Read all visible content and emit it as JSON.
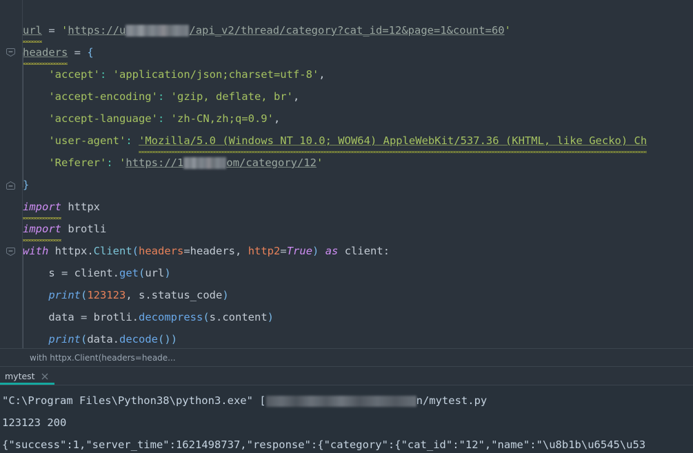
{
  "app": {
    "theme": "dark",
    "editor_bg": "#2b333c",
    "console_bg": "#28313a",
    "accent": "#15a9a0",
    "gutter_divider": "#3b444e"
  },
  "editor": {
    "language": "python",
    "lines": [
      {
        "id": "line-url",
        "fold": false,
        "tokens": [
          {
            "kind": "var-underline-squiggle",
            "text": "url"
          },
          {
            "kind": "plain",
            "text": " "
          },
          {
            "kind": "operator",
            "text": "="
          },
          {
            "kind": "plain",
            "text": " "
          },
          {
            "kind": "string-quote",
            "text": "'"
          },
          {
            "kind": "url",
            "text": "https://"
          },
          {
            "kind": "url-fragment",
            "text": "u"
          },
          {
            "kind": "redaction",
            "text": ""
          },
          {
            "kind": "url",
            "text": "/api_v2/thread/category?cat_id=12&page=1&count=60"
          },
          {
            "kind": "string-quote",
            "text": "'"
          }
        ]
      },
      {
        "id": "line-headers-open",
        "fold": true,
        "tokens": [
          {
            "kind": "var-underline-squiggle",
            "text": "headers"
          },
          {
            "kind": "plain",
            "text": " "
          },
          {
            "kind": "operator",
            "text": "="
          },
          {
            "kind": "plain",
            "text": " "
          },
          {
            "kind": "brace",
            "text": "{"
          }
        ]
      },
      {
        "id": "line-accept",
        "fold": false,
        "tokens": [
          {
            "kind": "plain",
            "text": "    "
          },
          {
            "kind": "string",
            "text": "'accept'"
          },
          {
            "kind": "colon",
            "text": ":"
          },
          {
            "kind": "plain",
            "text": " "
          },
          {
            "kind": "string",
            "text": "'application/json;charset=utf-8'"
          },
          {
            "kind": "punct",
            "text": ","
          }
        ]
      },
      {
        "id": "line-accept-encoding",
        "fold": false,
        "tokens": [
          {
            "kind": "plain",
            "text": "    "
          },
          {
            "kind": "string",
            "text": "'accept-encoding'"
          },
          {
            "kind": "colon",
            "text": ":"
          },
          {
            "kind": "plain",
            "text": " "
          },
          {
            "kind": "string",
            "text": "'gzip, deflate, br'"
          },
          {
            "kind": "punct",
            "text": ","
          }
        ]
      },
      {
        "id": "line-accept-language",
        "fold": false,
        "tokens": [
          {
            "kind": "plain",
            "text": "    "
          },
          {
            "kind": "string",
            "text": "'accept-language'"
          },
          {
            "kind": "colon",
            "text": ":"
          },
          {
            "kind": "plain",
            "text": " "
          },
          {
            "kind": "string",
            "text": "'zh-CN,zh;q=0.9'"
          },
          {
            "kind": "punct",
            "text": ","
          }
        ]
      },
      {
        "id": "line-user-agent",
        "fold": false,
        "tokens": [
          {
            "kind": "plain",
            "text": "    "
          },
          {
            "kind": "string",
            "text": "'user-agent'"
          },
          {
            "kind": "colon",
            "text": ":"
          },
          {
            "kind": "plain",
            "text": " "
          },
          {
            "kind": "string-squiggle",
            "text": "'Mozilla/5.0 (Windows NT 10.0; WOW64) AppleWebKit/537.36 (KHTML, like Gecko) Ch"
          }
        ]
      },
      {
        "id": "line-referer",
        "fold": false,
        "tokens": [
          {
            "kind": "plain",
            "text": "    "
          },
          {
            "kind": "string",
            "text": "'Referer'"
          },
          {
            "kind": "colon",
            "text": ":"
          },
          {
            "kind": "plain",
            "text": " "
          },
          {
            "kind": "string-quote",
            "text": "'"
          },
          {
            "kind": "url",
            "text": "https://"
          },
          {
            "kind": "url-fragment",
            "text": "1"
          },
          {
            "kind": "redaction-small",
            "text": ""
          },
          {
            "kind": "url",
            "text": "om/category/12"
          },
          {
            "kind": "string-quote",
            "text": "'"
          }
        ]
      },
      {
        "id": "line-headers-close",
        "fold": true,
        "tokens": [
          {
            "kind": "brace",
            "text": "}"
          }
        ]
      },
      {
        "id": "line-import-httpx",
        "fold": false,
        "tokens": [
          {
            "kind": "keyword-squiggle",
            "text": "import"
          },
          {
            "kind": "plain",
            "text": " "
          },
          {
            "kind": "plain",
            "text": "httpx"
          }
        ]
      },
      {
        "id": "line-import-brotli",
        "fold": false,
        "tokens": [
          {
            "kind": "keyword-squiggle",
            "text": "import"
          },
          {
            "kind": "plain",
            "text": " "
          },
          {
            "kind": "plain",
            "text": "brotli"
          }
        ]
      },
      {
        "id": "line-with",
        "fold": true,
        "tokens": [
          {
            "kind": "keyword",
            "text": "with"
          },
          {
            "kind": "plain",
            "text": " httpx."
          },
          {
            "kind": "class",
            "text": "Client"
          },
          {
            "kind": "paren",
            "text": "("
          },
          {
            "kind": "param",
            "text": "headers"
          },
          {
            "kind": "operator",
            "text": "="
          },
          {
            "kind": "plain",
            "text": "headers"
          },
          {
            "kind": "punct",
            "text": ","
          },
          {
            "kind": "plain",
            "text": " "
          },
          {
            "kind": "param",
            "text": "http2"
          },
          {
            "kind": "operator",
            "text": "="
          },
          {
            "kind": "keyword",
            "text": "True"
          },
          {
            "kind": "paren",
            "text": ")"
          },
          {
            "kind": "plain",
            "text": " "
          },
          {
            "kind": "keyword",
            "text": "as"
          },
          {
            "kind": "plain",
            "text": " client"
          },
          {
            "kind": "colon-plain",
            "text": ":"
          }
        ]
      },
      {
        "id": "line-get",
        "fold": false,
        "tokens": [
          {
            "kind": "plain",
            "text": "    s "
          },
          {
            "kind": "operator",
            "text": "="
          },
          {
            "kind": "plain",
            "text": " client."
          },
          {
            "kind": "func",
            "text": "get"
          },
          {
            "kind": "paren",
            "text": "("
          },
          {
            "kind": "plain",
            "text": "url"
          },
          {
            "kind": "paren",
            "text": ")"
          }
        ]
      },
      {
        "id": "line-print-status",
        "fold": false,
        "tokens": [
          {
            "kind": "plain",
            "text": "    "
          },
          {
            "kind": "builtin",
            "text": "print"
          },
          {
            "kind": "paren",
            "text": "("
          },
          {
            "kind": "number",
            "text": "123123"
          },
          {
            "kind": "punct",
            "text": ","
          },
          {
            "kind": "plain",
            "text": " s.status_code"
          },
          {
            "kind": "paren",
            "text": ")"
          }
        ]
      },
      {
        "id": "line-decompress",
        "fold": false,
        "tokens": [
          {
            "kind": "plain",
            "text": "    data "
          },
          {
            "kind": "operator",
            "text": "="
          },
          {
            "kind": "plain",
            "text": " brotli."
          },
          {
            "kind": "func",
            "text": "decompress"
          },
          {
            "kind": "paren",
            "text": "("
          },
          {
            "kind": "plain",
            "text": "s.content"
          },
          {
            "kind": "paren",
            "text": ")"
          }
        ]
      },
      {
        "id": "line-print-decode",
        "fold": false,
        "tokens": [
          {
            "kind": "plain",
            "text": "    "
          },
          {
            "kind": "builtin",
            "text": "print"
          },
          {
            "kind": "paren",
            "text": "("
          },
          {
            "kind": "plain",
            "text": "data."
          },
          {
            "kind": "func",
            "text": "decode"
          },
          {
            "kind": "paren",
            "text": "()"
          },
          {
            "kind": "paren",
            "text": ")"
          }
        ]
      }
    ]
  },
  "breadcrumb": {
    "text": "with httpx.Client(headers=heade..."
  },
  "tool_window": {
    "tabs": [
      {
        "label": "mytest",
        "active": true,
        "close_icon": "close-icon"
      }
    ]
  },
  "console": {
    "lines": [
      {
        "id": "console-command",
        "segments": [
          {
            "kind": "text",
            "text": "\"C:\\Program Files\\Python38\\python3.exe\" ["
          },
          {
            "kind": "redaction",
            "text": ""
          },
          {
            "kind": "text",
            "text": "n/mytest.py"
          }
        ]
      },
      {
        "id": "console-status",
        "segments": [
          {
            "kind": "text",
            "text": "123123 200"
          }
        ]
      },
      {
        "id": "console-json",
        "segments": [
          {
            "kind": "text",
            "text": "{\"success\":1,\"server_time\":1621498737,\"response\":{\"category\":{\"cat_id\":\"12\",\"name\":\"\\u8b1b\\u6545\\u53"
          }
        ]
      }
    ]
  }
}
